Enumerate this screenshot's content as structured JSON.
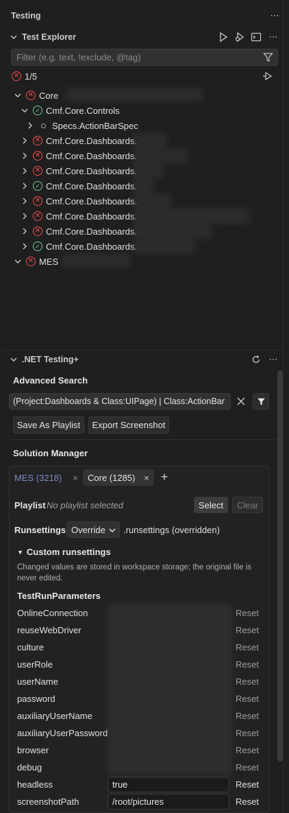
{
  "testing": {
    "title": "Testing"
  },
  "explorer": {
    "title": "Test Explorer",
    "filter_placeholder": "Filter (e.g. text, !exclude, @tag)",
    "result_count": "1/5",
    "tree": [
      {
        "label": "Core",
        "status": "fail",
        "expanded": true
      },
      {
        "label": "Cmf.Core.Controls",
        "status": "pass",
        "expanded": true
      },
      {
        "label": "Specs.ActionBarSpec",
        "status": "none",
        "expanded": false
      },
      {
        "label": "Cmf.Core.Dashboards.",
        "status": "fail",
        "expanded": false
      },
      {
        "label": "Cmf.Core.Dashboards.",
        "status": "fail",
        "expanded": false
      },
      {
        "label": "Cmf.Core.Dashboards.",
        "status": "fail",
        "expanded": false
      },
      {
        "label": "Cmf.Core.Dashboards.",
        "status": "pass",
        "expanded": false
      },
      {
        "label": "Cmf.Core.Dashboards.",
        "status": "fail",
        "expanded": false
      },
      {
        "label": "Cmf.Core.Dashboards.",
        "status": "fail",
        "expanded": false
      },
      {
        "label": "Cmf.Core.Dashboards.",
        "status": "fail",
        "expanded": false
      },
      {
        "label": "Cmf.Core.Dashboards.",
        "status": "pass",
        "expanded": false
      },
      {
        "label": "MES",
        "status": "fail",
        "expanded": true
      }
    ]
  },
  "dotnet": {
    "title": ".NET Testing+",
    "advanced_search_title": "Advanced Search",
    "search_value": "(Project:Dashboards & Class:UIPage) | Class:ActionBar",
    "save_playlist": "Save As Playlist",
    "export_screenshot": "Export Screenshot",
    "solution_manager_title": "Solution Manager",
    "tabs": [
      {
        "label": "MES (3218)",
        "active": false
      },
      {
        "label": "Core (1285)",
        "active": true
      }
    ],
    "playlist_label": "Playlist",
    "playlist_value": "No playlist selected",
    "select_button": "Select",
    "clear_button": "Clear",
    "runsettings_label": "Runsettings",
    "runsettings_select": "Override",
    "runsettings_note": ".runsettings (overridden)",
    "custom_title": "Custom runsettings",
    "custom_note": "Changed values are stored in workspace storage; the original file is never edited.",
    "params_title": "TestRunParameters",
    "reset_label": "Reset",
    "params": [
      {
        "name": "OnlineConnection",
        "value": ""
      },
      {
        "name": "reuseWebDriver",
        "value": ""
      },
      {
        "name": "culture",
        "value": ""
      },
      {
        "name": "userRole",
        "value": ""
      },
      {
        "name": "userName",
        "value": ""
      },
      {
        "name": "password",
        "value": ""
      },
      {
        "name": "auxiliaryUserName",
        "value": ""
      },
      {
        "name": "auxiliaryUserPassword",
        "value": ""
      },
      {
        "name": "browser",
        "value": ""
      },
      {
        "name": "debug",
        "value": ""
      },
      {
        "name": "headless",
        "value": "true"
      },
      {
        "name": "screenshotPath",
        "value": "/root/pictures"
      }
    ]
  },
  "colors": {
    "fail": "#f14c4c",
    "pass": "#73c991",
    "bg": "#1f1f1f"
  }
}
